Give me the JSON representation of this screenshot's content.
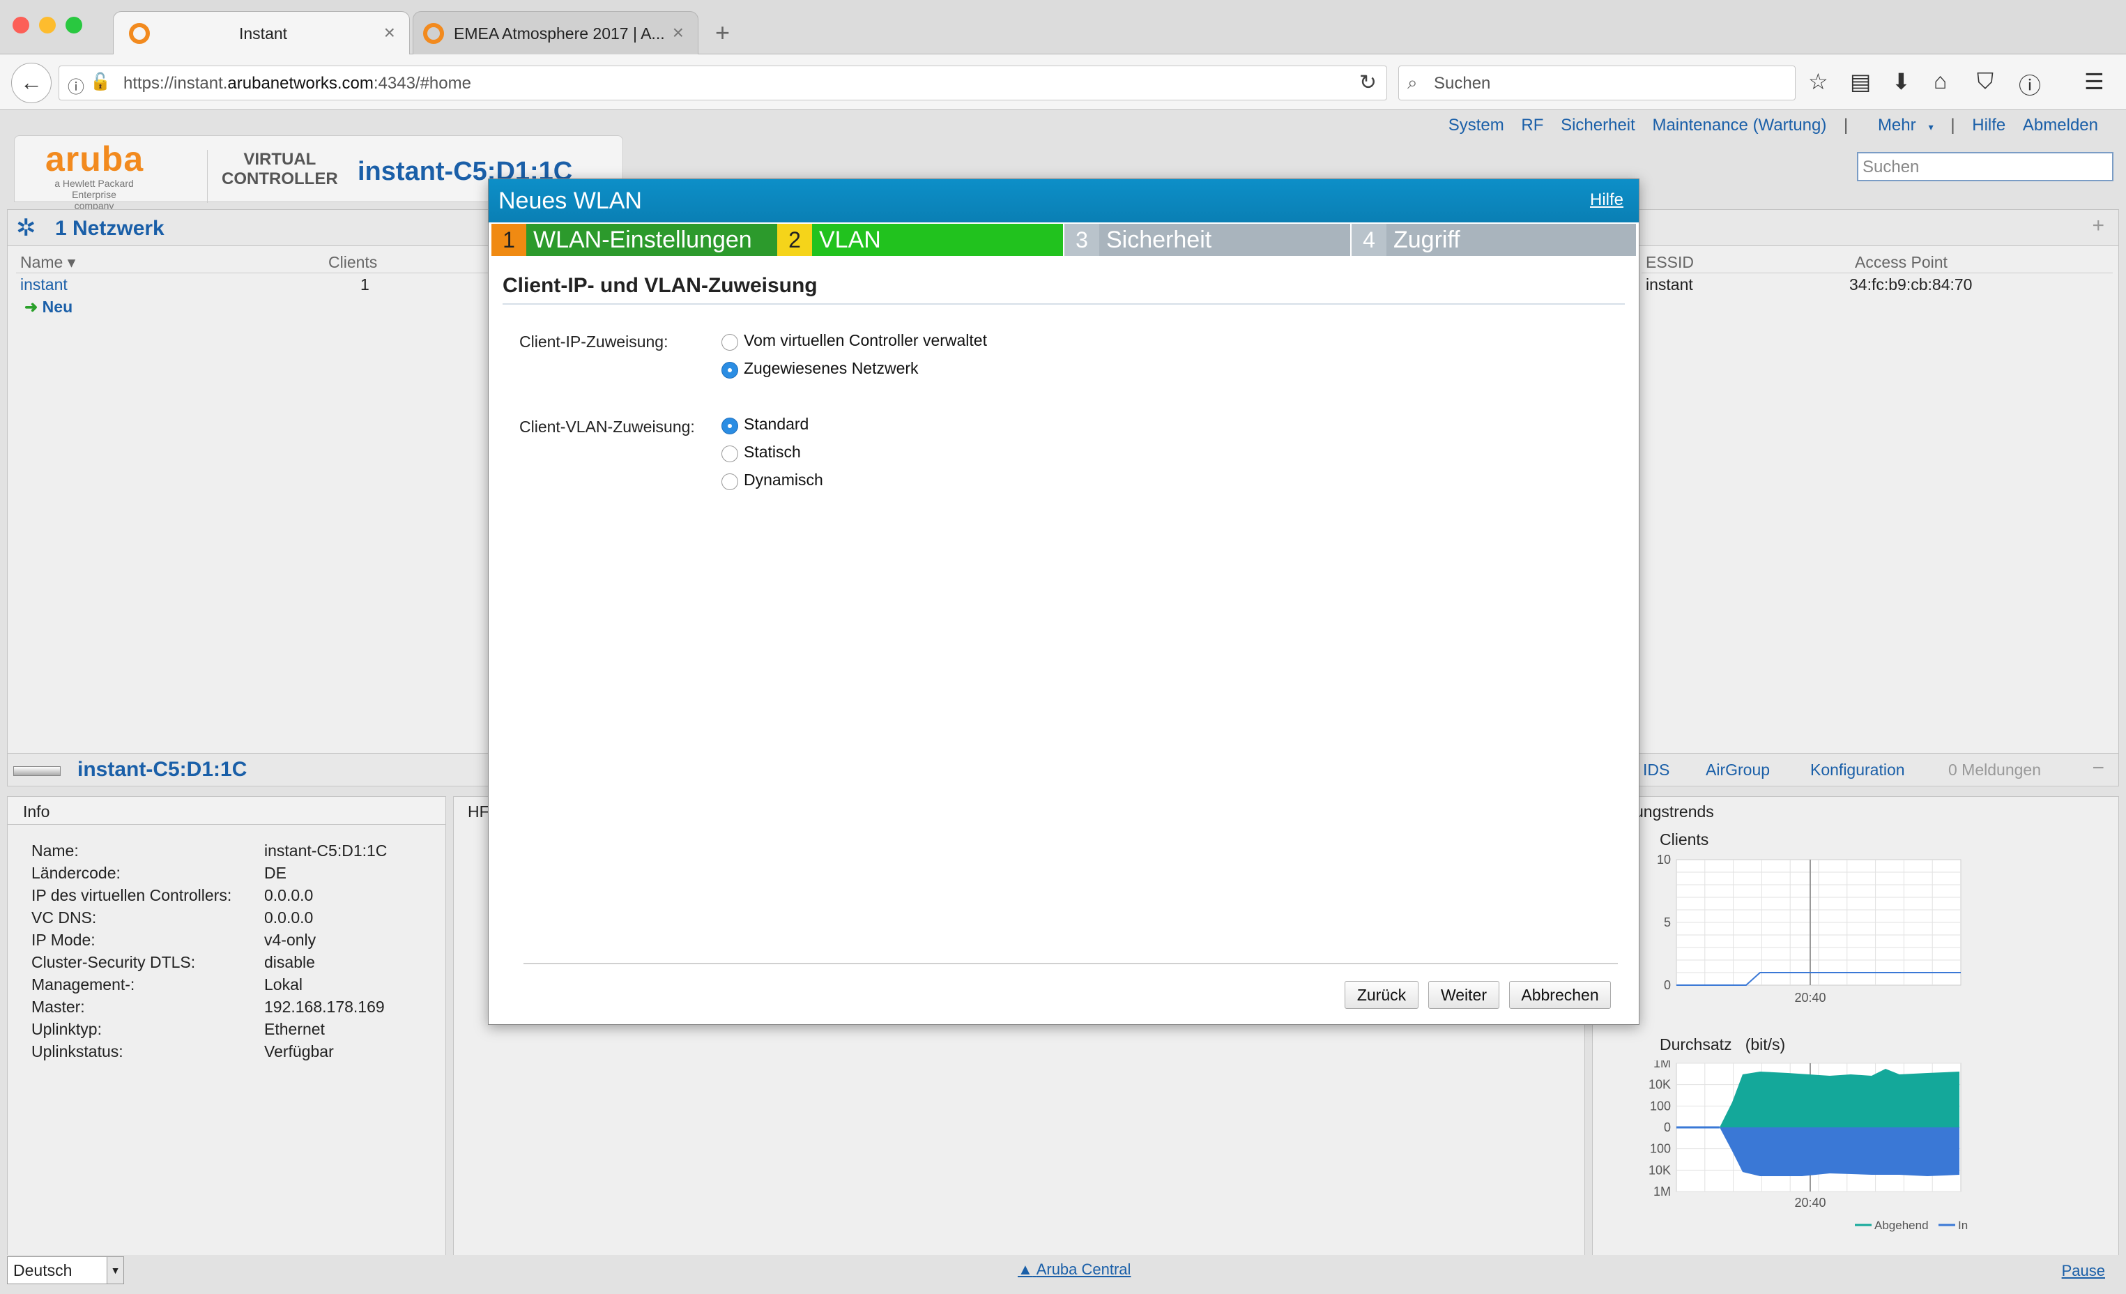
{
  "browser": {
    "tabs": [
      {
        "title": "Instant",
        "active": true
      },
      {
        "title": "EMEA Atmosphere 2017 | A...",
        "active": false
      }
    ],
    "url_prefix": "https://instant.",
    "url_domain": "arubanetworks.com",
    "url_suffix": ":4343/#home",
    "search_placeholder": "Suchen"
  },
  "topnav": {
    "items": [
      "System",
      "RF",
      "Sicherheit",
      "Maintenance (Wartung)",
      "Mehr",
      "Hilfe",
      "Abmelden"
    ],
    "search_placeholder": "Suchen"
  },
  "header": {
    "logo": "aruba",
    "logo_sub": "a Hewlett Packard Enterprise company",
    "vc_label_1": "VIRTUAL",
    "vc_label_2": "CONTROLLER",
    "vc_name": "instant-C5:D1:1C"
  },
  "networks": {
    "title": "1 Netzwerk",
    "columns": [
      "Name",
      "Clients"
    ],
    "rows": [
      {
        "name": "instant",
        "clients": "1"
      }
    ],
    "new_label": "Neu"
  },
  "aps": {
    "columns": [
      "ESSID",
      "Access Point"
    ],
    "rows": [
      {
        "essid": "instant",
        "ap": "34:fc:b9:cb:84:70"
      }
    ]
  },
  "device": {
    "title": "instant-C5:D1:1C",
    "tabs": [
      "IDS",
      "AirGroup",
      "Konfiguration",
      "0 Meldungen"
    ]
  },
  "info": {
    "title": "Info",
    "rows": [
      {
        "k": "Name:",
        "v": "instant-C5:D1:1C"
      },
      {
        "k": "Ländercode:",
        "v": "DE"
      },
      {
        "k": "IP des virtuellen Controllers:",
        "v": "0.0.0.0"
      },
      {
        "k": "VC DNS:",
        "v": "0.0.0.0"
      },
      {
        "k": "IP Mode:",
        "v": "v4-only"
      },
      {
        "k": "Cluster-Security DTLS:",
        "v": "disable"
      },
      {
        "k": "Management-:",
        "v": "Lokal"
      },
      {
        "k": "Master:",
        "v": "192.168.178.169"
      },
      {
        "k": "Uplinktyp:",
        "v": "Ethernet"
      },
      {
        "k": "Uplinkstatus:",
        "v": "Verfügbar"
      }
    ]
  },
  "middle_panel_title": "HF",
  "trends": {
    "title": "ungstrends",
    "clients_title": "Clients",
    "clients_y": [
      "10",
      "5",
      "0"
    ],
    "clients_x": "20:40",
    "throughput_title": "Durchsatz",
    "throughput_unit": "(bit/s)",
    "throughput_y": [
      "1M",
      "10K",
      "100",
      "0",
      "100",
      "10K",
      "1M"
    ],
    "throughput_x": "20:40",
    "legend_out": "Abgehend",
    "legend_in": "In",
    "color_out": "#14a89a",
    "color_in": "#3a78d6"
  },
  "modal": {
    "title": "Neues WLAN",
    "help": "Hilfe",
    "steps": [
      {
        "num": "1",
        "label": "WLAN-Einstellungen",
        "state": "done"
      },
      {
        "num": "2",
        "label": "VLAN",
        "state": "current"
      },
      {
        "num": "3",
        "label": "Sicherheit",
        "state": "todo"
      },
      {
        "num": "4",
        "label": "Zugriff",
        "state": "todo"
      }
    ],
    "section_title": "Client-IP- und VLAN-Zuweisung",
    "ip_label": "Client-IP-Zuweisung:",
    "ip_options": [
      "Vom virtuellen Controller verwaltet",
      "Zugewiesenes Netzwerk"
    ],
    "ip_selected": "Zugewiesenes Netzwerk",
    "vlan_label": "Client-VLAN-Zuweisung:",
    "vlan_options": [
      "Standard",
      "Statisch",
      "Dynamisch"
    ],
    "vlan_selected": "Standard",
    "buttons": {
      "back": "Zurück",
      "next": "Weiter",
      "cancel": "Abbrechen"
    }
  },
  "footer": {
    "language": "Deutsch",
    "central": "Aruba Central",
    "pause": "Pause"
  }
}
